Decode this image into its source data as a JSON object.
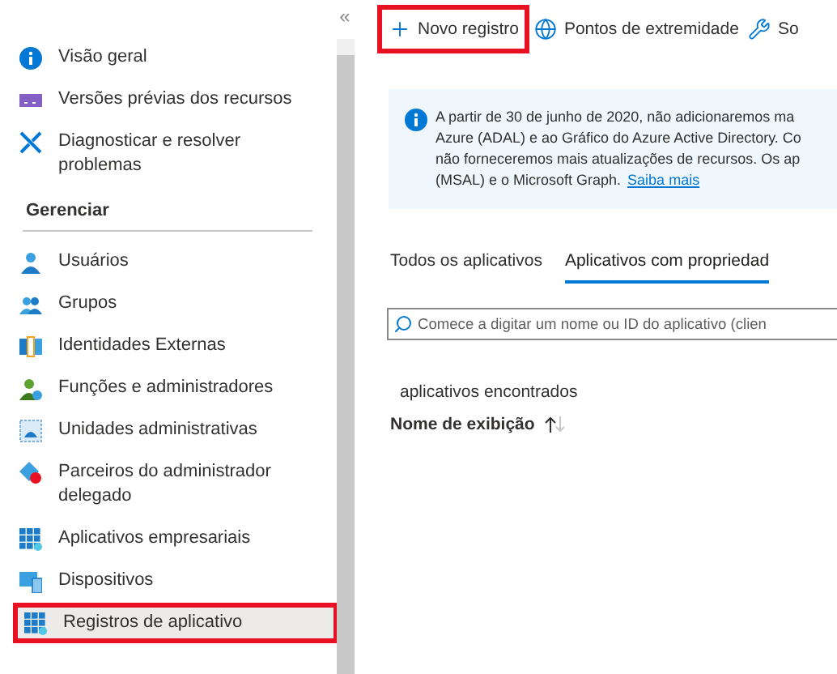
{
  "sidebar": {
    "collapse_glyph": "«",
    "items": [
      {
        "kind": "item",
        "label": "Visão geral",
        "selected": false,
        "highlighted": false
      },
      {
        "kind": "item",
        "label": "Versões prévias dos recursos",
        "selected": false,
        "highlighted": false
      },
      {
        "kind": "item",
        "label": "Diagnosticar e resolver problemas",
        "selected": false,
        "highlighted": false
      },
      {
        "kind": "header",
        "label": "Gerenciar"
      },
      {
        "kind": "item",
        "label": "Usuários",
        "selected": false,
        "highlighted": false
      },
      {
        "kind": "item",
        "label": "Grupos",
        "selected": false,
        "highlighted": false
      },
      {
        "kind": "item",
        "label": "Identidades Externas",
        "selected": false,
        "highlighted": false
      },
      {
        "kind": "item",
        "label": "Funções e administradores",
        "selected": false,
        "highlighted": false
      },
      {
        "kind": "item",
        "label": "Unidades administrativas",
        "selected": false,
        "highlighted": false
      },
      {
        "kind": "item",
        "label": "Parceiros do administrador delegado",
        "selected": false,
        "highlighted": false
      },
      {
        "kind": "item",
        "label": "Aplicativos empresariais",
        "selected": false,
        "highlighted": false
      },
      {
        "kind": "item",
        "label": "Dispositivos",
        "selected": false,
        "highlighted": false
      },
      {
        "kind": "item",
        "label": "Registros de aplicativo",
        "selected": true,
        "highlighted": true
      }
    ]
  },
  "toolbar": [
    {
      "label": "Novo registro",
      "highlighted": true
    },
    {
      "label": "Pontos de extremidade",
      "highlighted": false
    },
    {
      "label": "So",
      "highlighted": false
    }
  ],
  "banner": {
    "lines": [
      "A partir de 30 de junho de 2020, não adicionaremos ma",
      "Azure (ADAL) e ao Gráfico do Azure Active Directory. Co",
      "não forneceremos mais atualizações de recursos. Os ap",
      "(MSAL) e o Microsoft Graph."
    ],
    "link": "Saiba mais"
  },
  "tabs": [
    {
      "label": "Todos os aplicativos",
      "selected": false
    },
    {
      "label": "Aplicativos com propriedad",
      "selected": true
    }
  ],
  "search": {
    "placeholder": "Comece a digitar um nome ou ID do aplicativo (clien"
  },
  "results_label": "aplicativos encontrados",
  "columns": [
    {
      "label": "Nome de exibição",
      "sorted": true
    }
  ]
}
